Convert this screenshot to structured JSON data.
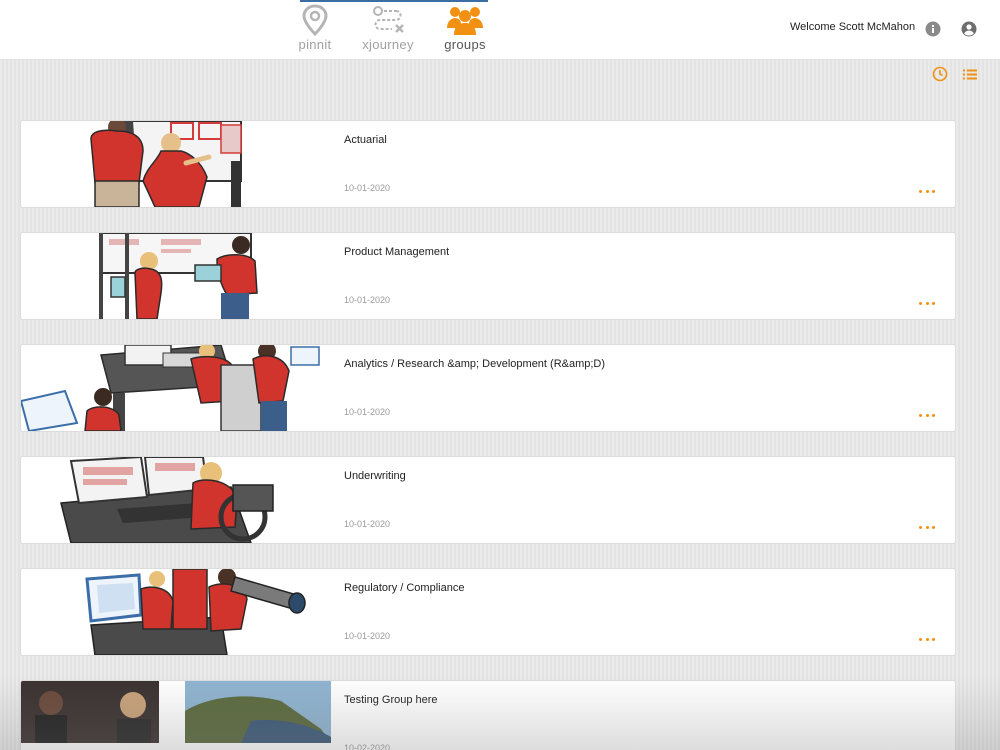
{
  "header": {
    "apps": [
      {
        "label": "pinnit",
        "icon": "map-pin-icon",
        "active": false
      },
      {
        "label": "xjourney",
        "icon": "journey-path-icon",
        "active": false
      },
      {
        "label": "groups",
        "icon": "groups-people-icon",
        "active": true
      }
    ],
    "welcome_text": "Welcome Scott McMahon",
    "info_icon": "info-icon",
    "account_icon": "account-icon"
  },
  "toolbar": {
    "recent_icon": "clock-icon",
    "list_icon": "list-view-icon",
    "accent_color": "#f29111"
  },
  "groups": [
    {
      "title": "Actuarial",
      "date": "10-01-2020",
      "image": "illustration-two-people-at-whiteboard"
    },
    {
      "title": "Product Management",
      "date": "10-01-2020",
      "image": "illustration-people-with-tablets"
    },
    {
      "title": "Analytics / Research &amp; Development (R&amp;D)",
      "date": "10-01-2020",
      "image": "illustration-people-at-desks"
    },
    {
      "title": "Underwriting",
      "date": "10-01-2020",
      "image": "illustration-person-at-computer"
    },
    {
      "title": "Regulatory / Compliance",
      "date": "10-01-2020",
      "image": "illustration-people-with-telescope"
    },
    {
      "title": "Testing Group here",
      "date": "10-02-2020",
      "image": "photo-thumbnails"
    }
  ]
}
